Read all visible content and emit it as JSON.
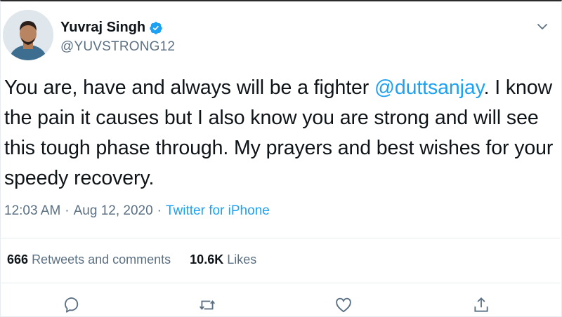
{
  "header": {
    "display_name": "Yuvraj Singh",
    "handle": "@YUVSTRONG12",
    "verified": true,
    "icons": {
      "avatar": "profile-photo",
      "verified": "verified-badge-icon",
      "menu": "chevron-down-icon"
    }
  },
  "tweet": {
    "text_before": "You are, have and always will be a fighter ",
    "mention": "@duttsanjay",
    "text_after": ". I know the pain it causes but I also know you are strong and will see this tough phase through. My prayers and best wishes for your speedy recovery."
  },
  "meta": {
    "time": "12:03 AM",
    "separator": "·",
    "date": "Aug 12, 2020",
    "source": "Twitter for iPhone"
  },
  "stats": {
    "retweets_count": "666",
    "retweets_label": "Retweets and comments",
    "likes_count": "10.6K",
    "likes_label": "Likes"
  },
  "actions": [
    "reply-icon",
    "retweet-icon",
    "like-icon",
    "share-icon"
  ],
  "colors": {
    "accent": "#1da1f2",
    "text": "#0f1419",
    "secondary": "#5b7083",
    "divider": "#e6ecf0"
  }
}
